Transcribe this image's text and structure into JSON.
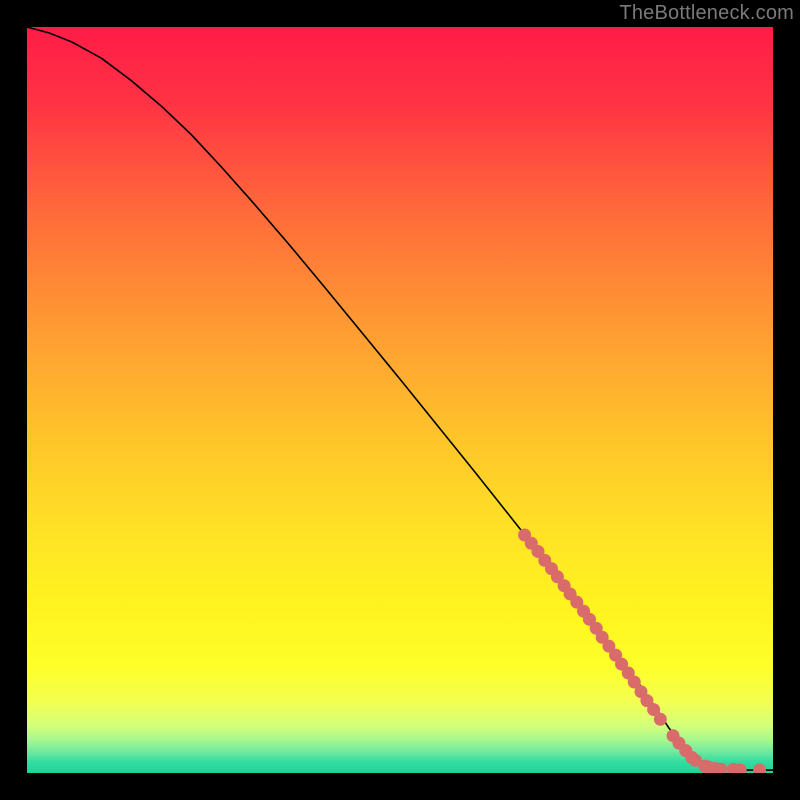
{
  "attribution": "TheBottleneck.com",
  "colors": {
    "curve": "#000000",
    "marker_fill": "#d96b6b",
    "marker_stroke": "#c05858",
    "gradient_stops": [
      {
        "offset": 0.0,
        "color": "#ff1c47"
      },
      {
        "offset": 0.1,
        "color": "#ff3244"
      },
      {
        "offset": 0.25,
        "color": "#ff6b3a"
      },
      {
        "offset": 0.4,
        "color": "#ff9a33"
      },
      {
        "offset": 0.55,
        "color": "#ffc42a"
      },
      {
        "offset": 0.68,
        "color": "#ffe326"
      },
      {
        "offset": 0.78,
        "color": "#fff41f"
      },
      {
        "offset": 0.86,
        "color": "#feff2a"
      },
      {
        "offset": 0.905,
        "color": "#f2ff52"
      },
      {
        "offset": 0.935,
        "color": "#d6ff78"
      },
      {
        "offset": 0.955,
        "color": "#a8f88e"
      },
      {
        "offset": 0.972,
        "color": "#6de9a0"
      },
      {
        "offset": 0.985,
        "color": "#34dca0"
      },
      {
        "offset": 1.0,
        "color": "#1ed498"
      }
    ]
  },
  "chart_data": {
    "type": "line",
    "title": "",
    "xlabel": "",
    "ylabel": "",
    "xlim": [
      0,
      100
    ],
    "ylim": [
      0,
      100
    ],
    "grid": false,
    "legend": false,
    "series": [
      {
        "name": "curve",
        "x": [
          0,
          3,
          6,
          10,
          14,
          18,
          22,
          26,
          30,
          35,
          40,
          45,
          50,
          55,
          60,
          65,
          70,
          74,
          77,
          80,
          82.5,
          84.5,
          86,
          88,
          90,
          92,
          94,
          96,
          98,
          100
        ],
        "y": [
          100,
          99.2,
          98.0,
          95.8,
          92.8,
          89.4,
          85.6,
          81.3,
          76.8,
          71.0,
          65.0,
          58.9,
          52.8,
          46.6,
          40.4,
          34.1,
          27.8,
          22.7,
          18.8,
          14.8,
          11.3,
          8.4,
          6.1,
          3.6,
          1.8,
          0.9,
          0.5,
          0.4,
          0.4,
          0.4
        ]
      }
    ],
    "markers": {
      "name": "highlighted-points",
      "x": [
        66.7,
        67.6,
        68.5,
        69.4,
        70.3,
        71.1,
        72.0,
        72.8,
        73.7,
        74.6,
        75.4,
        76.3,
        77.1,
        78.0,
        78.9,
        79.7,
        80.6,
        81.4,
        82.3,
        83.1,
        84.0,
        84.9,
        86.6,
        87.4,
        88.3,
        89.1,
        89.6,
        90.9,
        91.3,
        92.2,
        93.0,
        94.7,
        95.6,
        98.2
      ],
      "y": [
        31.9,
        30.8,
        29.7,
        28.5,
        27.4,
        26.3,
        25.1,
        24.0,
        22.9,
        21.7,
        20.6,
        19.4,
        18.2,
        17.0,
        15.8,
        14.6,
        13.4,
        12.2,
        10.9,
        9.7,
        8.5,
        7.2,
        5.0,
        4.0,
        3.0,
        2.1,
        1.7,
        0.9,
        0.8,
        0.6,
        0.5,
        0.5,
        0.4,
        0.4
      ]
    }
  }
}
